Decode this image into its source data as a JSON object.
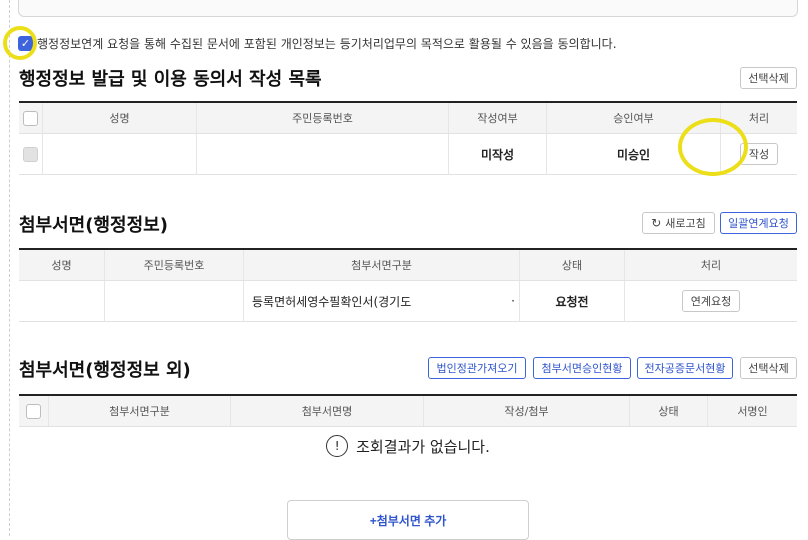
{
  "agreement": {
    "text": "행정정보연계 요청을 통해 수집된 문서에 포함된 개인정보는 등기처리업무의 목적으로 활용될 수 있음을 동의합니다.",
    "checked": true,
    "check_mark": "✓"
  },
  "section1": {
    "title": "행정정보 발급 및 이용 동의서 작성 목록",
    "delete_button": "선택삭제",
    "headers": [
      "성명",
      "주민등록번호",
      "작성여부",
      "승인여부",
      "처리"
    ],
    "rows": [
      {
        "name": "",
        "rrn": "",
        "written": "미작성",
        "approved": "미승인",
        "action": "작성"
      }
    ]
  },
  "section2": {
    "title": "첨부서면(행정정보)",
    "refresh_button": "새로고침",
    "refresh_icon": "refresh-icon",
    "bulk_button": "일괄연계요청",
    "headers": [
      "성명",
      "주민등록번호",
      "첨부서면구분",
      "상태",
      "처리"
    ],
    "rows": [
      {
        "name": "",
        "rrn": "",
        "doc_type": "등록면허세영수필확인서(경기도",
        "doc_suffix": "·",
        "status": "요청전",
        "action": "연계요청"
      }
    ]
  },
  "section3": {
    "title": "첨부서면(행정정보 외)",
    "buttons": [
      "법인정관가져오기",
      "첨부서면승인현황",
      "전자공증문서현황",
      "선택삭제"
    ],
    "headers": [
      "첨부서면구분",
      "첨부서면명",
      "작성/첨부",
      "상태",
      "서명인"
    ],
    "empty_icon": "!",
    "empty_message": "조회결과가 없습니다.",
    "add_button": "+첨부서면 추가"
  },
  "colors": {
    "accent": "#3d63dd",
    "highlight": "#ecdf1a"
  }
}
